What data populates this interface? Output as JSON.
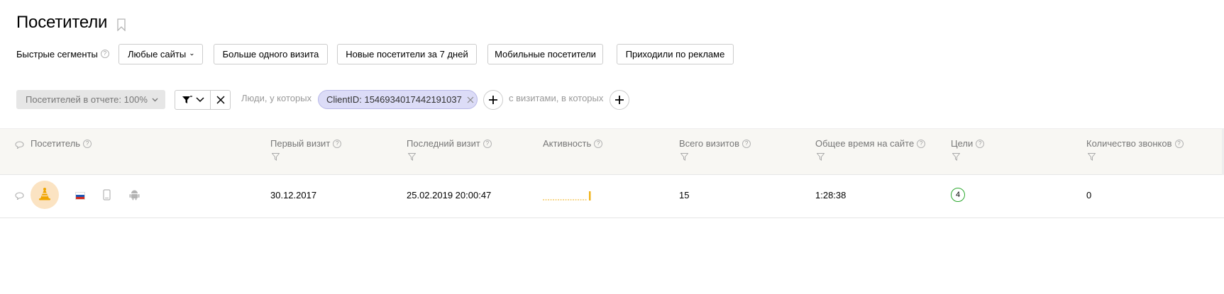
{
  "page": {
    "title": "Посетители",
    "bookmark_icon": "bookmark-icon"
  },
  "segments": {
    "label": "Быстрые сегменты",
    "help": "?",
    "buttons": [
      "Любые сайты",
      "Больше одного визита",
      "Новые посетители за 7 дней",
      "Мобильные посетители",
      "Приходили по рекламе"
    ]
  },
  "filters": {
    "visitors_in_report": "Посетителей в отчете: 100%",
    "people_label": "Люди, у которых",
    "chip": "ClientID: 1546934017442191037",
    "visits_label": "с визитами, в которых"
  },
  "table": {
    "columns": [
      "Посетитель",
      "Первый визит",
      "Последний визит",
      "Активность",
      "Всего визитов",
      "Общее время на сайте",
      "Цели",
      "Количество звонков"
    ],
    "rows": [
      {
        "first_visit": "30.12.2017",
        "last_visit": "25.02.2019 20:00:47",
        "total_visits": "15",
        "time_on_site": "1:28:38",
        "goals": "4",
        "calls": "0",
        "country_flag": "russia-flag-icon",
        "device": "mobile-phone-icon",
        "os": "android-icon"
      }
    ]
  },
  "colors": {
    "chip_bg": "#dcdcf7",
    "goal_ring": "#2ea830",
    "activity": "#f0b31c",
    "avatar_bg": "#fbe3c2",
    "header_bg": "#f8f7f3"
  }
}
